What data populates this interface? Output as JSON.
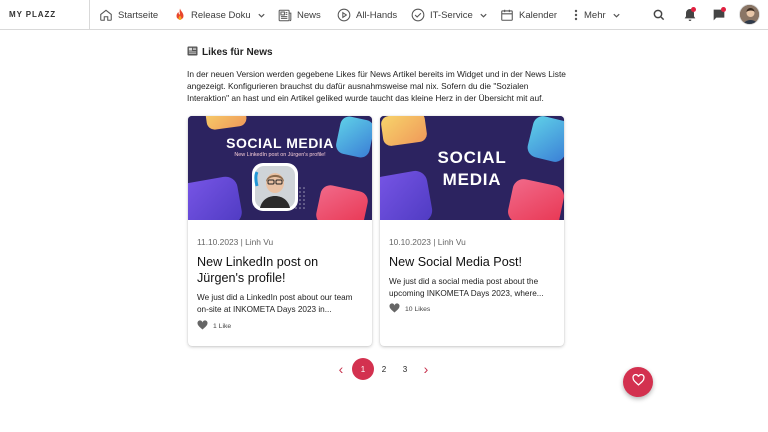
{
  "brand": {
    "name": "MY PLAZZ"
  },
  "nav": {
    "items": [
      {
        "label": "Startseite",
        "icon": "home-icon"
      },
      {
        "label": "Release Doku",
        "icon": "flame-icon",
        "has_dropdown": true
      },
      {
        "label": "News",
        "icon": "newspaper-icon"
      },
      {
        "label": "All-Hands",
        "icon": "play-circle-icon"
      },
      {
        "label": "IT-Service",
        "icon": "check-circle-icon",
        "has_dropdown": true
      },
      {
        "label": "Kalender",
        "icon": "calendar-icon"
      },
      {
        "label": "Mehr",
        "icon": "more-vertical-icon",
        "has_dropdown": true
      }
    ],
    "right_icons": [
      "search-icon",
      "bell-icon",
      "chat-icon",
      "avatar"
    ],
    "notification_color": "#e0203f"
  },
  "article": {
    "title": "Likes für News",
    "title_icon": "newspaper-icon",
    "body": "In der neuen Version werden gegebene Likes für News Artikel bereits im Widget und in der News Liste angezeigt. Konfigurieren brauchst du dafür ausnahmsweise mal nix. Sofern du die \"Sozialen Interaktion\" an hast und ein Artikel geliked wurde taucht das kleine Herz in der Übersicht mit auf."
  },
  "cards": [
    {
      "image_title": "SOCIAL MEDIA",
      "image_subtitle": "New LinkedIn post on Jürgen's profile!",
      "meta": "11.10.2023 | Linh Vu",
      "title": "New LinkedIn post on Jürgen's profile!",
      "excerpt": "We just did a LinkedIn post about our team on-site at INKOMETA Days 2023 in...",
      "likes": "1 Like"
    },
    {
      "image_title_line1": "SOCIAL",
      "image_title_line2": "MEDIA",
      "meta": "10.10.2023 | Linh Vu",
      "title": "New Social Media Post!",
      "excerpt": "We just did a social media post about the upcoming INKOMETA Days 2023, where...",
      "likes": "10 Likes"
    }
  ],
  "pagination": {
    "prev": "‹",
    "pages": [
      "1",
      "2",
      "3"
    ],
    "active": "1",
    "next": "›"
  },
  "colors": {
    "accent": "#d3314f",
    "image_bg": "#2c2360"
  }
}
